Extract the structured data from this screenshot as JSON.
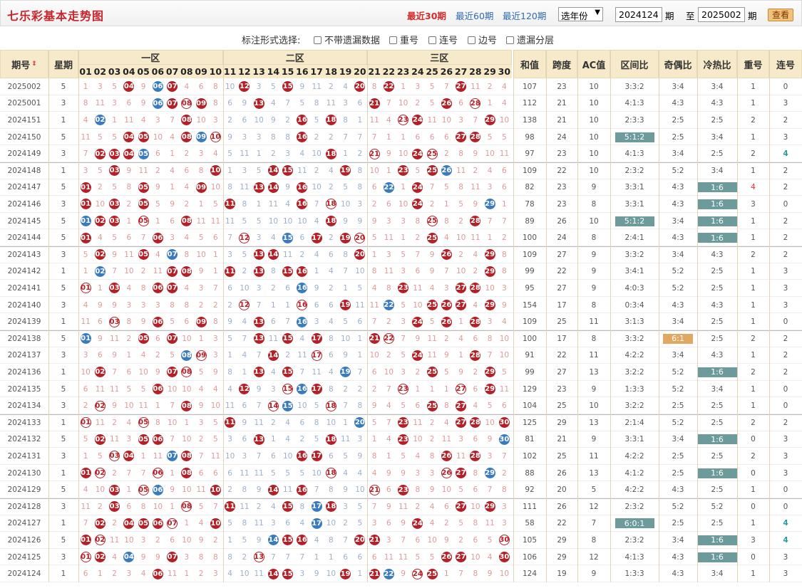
{
  "page": {
    "title": "七乐彩基本走势图",
    "range": [
      "最近30期",
      "最近60期",
      "最近120期"
    ],
    "year_select": "选年份",
    "from": "2024124",
    "to": "2025002",
    "qi": "期",
    "zhi": "至",
    "view": "查看"
  },
  "options": {
    "label": "标注形式选择:",
    "items": [
      "不带遗漏数据",
      "重号",
      "连号",
      "边号",
      "遗漏分层"
    ]
  },
  "headers": {
    "period": "期号",
    "week": "星期",
    "zones": [
      "一区",
      "二区",
      "三区"
    ],
    "numbers": [
      "01",
      "02",
      "03",
      "04",
      "05",
      "06",
      "07",
      "08",
      "09",
      "10",
      "11",
      "12",
      "13",
      "14",
      "15",
      "16",
      "17",
      "18",
      "19",
      "20",
      "21",
      "22",
      "23",
      "24",
      "25",
      "26",
      "27",
      "28",
      "29",
      "30"
    ],
    "stats": [
      "和值",
      "跨度",
      "AC值",
      "区间比",
      "奇偶比",
      "冷热比",
      "重号",
      "连号"
    ]
  },
  "rows": [
    {
      "p": "2025002",
      "w": "5",
      "hit": [
        "04",
        "06",
        "07",
        "12",
        "15",
        "20",
        "22",
        "27"
      ],
      "blue": [
        "06"
      ],
      "s": [
        "107",
        "23",
        "10",
        "3:3:2",
        "3:4",
        "3:4",
        "1",
        "0"
      ]
    },
    {
      "p": "2025001",
      "w": "3",
      "hit": [
        "06",
        "07",
        "08",
        "09",
        "13",
        "21",
        "26",
        "28"
      ],
      "blue": [
        "06"
      ],
      "s": [
        "112",
        "21",
        "10",
        "4:1:3",
        "4:3",
        "4:3",
        "1",
        "3"
      ]
    },
    {
      "p": "2024151",
      "w": "1",
      "hit": [
        "02",
        "08",
        "16",
        "18",
        "23",
        "24",
        "29"
      ],
      "blue": [
        "02"
      ],
      "s": [
        "138",
        "21",
        "10",
        "2:3:3",
        "2:5",
        "2:5",
        "2",
        "2"
      ]
    },
    {
      "p": "2024150",
      "w": "5",
      "hit": [
        "04",
        "05",
        "08",
        "09",
        "10",
        "16",
        "27",
        "28"
      ],
      "blue": [
        "09"
      ],
      "s": [
        "98",
        "24",
        "10",
        "5:1:2",
        "2:5",
        "3:4",
        "1",
        "3"
      ]
    },
    {
      "p": "2024149",
      "w": "3",
      "hit": [
        "02",
        "03",
        "04",
        "05",
        "18",
        "21",
        "24",
        "25"
      ],
      "blue": [
        "05"
      ],
      "s": [
        "97",
        "23",
        "10",
        "4:1:3",
        "3:4",
        "2:5",
        "2",
        "4"
      ]
    },
    {
      "p": "2024148",
      "w": "1",
      "hit": [
        "03",
        "10",
        "14",
        "15",
        "19",
        "23",
        "25",
        "26"
      ],
      "blue": [
        "26"
      ],
      "s": [
        "109",
        "22",
        "10",
        "2:3:2",
        "5:2",
        "3:4",
        "1",
        "2"
      ]
    },
    {
      "p": "2024147",
      "w": "5",
      "hit": [
        "01",
        "05",
        "09",
        "13",
        "14",
        "16",
        "22",
        "24"
      ],
      "blue": [
        "22"
      ],
      "s": [
        "82",
        "23",
        "9",
        "3:3:1",
        "4:3",
        "1:6",
        "4",
        "2"
      ]
    },
    {
      "p": "2024146",
      "w": "3",
      "hit": [
        "01",
        "03",
        "05",
        "11",
        "16",
        "18",
        "24",
        "29"
      ],
      "blue": [
        "29"
      ],
      "s": [
        "78",
        "23",
        "8",
        "3:3:1",
        "4:3",
        "1:6",
        "3",
        "0"
      ]
    },
    {
      "p": "2024145",
      "w": "5",
      "hit": [
        "01",
        "02",
        "03",
        "05",
        "08",
        "18",
        "25",
        "28"
      ],
      "blue": [
        "01"
      ],
      "s": [
        "89",
        "26",
        "10",
        "5:1:2",
        "3:4",
        "1:6",
        "1",
        "2"
      ]
    },
    {
      "p": "2024144",
      "w": "5",
      "hit": [
        "01",
        "06",
        "12",
        "15",
        "17",
        "19",
        "20",
        "25"
      ],
      "blue": [
        "15"
      ],
      "s": [
        "100",
        "24",
        "8",
        "2:4:1",
        "4:3",
        "1:6",
        "1",
        "2"
      ]
    },
    {
      "p": "2024143",
      "w": "3",
      "hit": [
        "02",
        "05",
        "07",
        "13",
        "14",
        "20",
        "26",
        "29"
      ],
      "blue": [
        "07"
      ],
      "s": [
        "109",
        "27",
        "9",
        "3:3:2",
        "3:4",
        "4:3",
        "2",
        "2"
      ]
    },
    {
      "p": "2024142",
      "w": "1",
      "hit": [
        "02",
        "07",
        "08",
        "11",
        "13",
        "15",
        "16",
        "29"
      ],
      "blue": [
        "02"
      ],
      "s": [
        "99",
        "22",
        "9",
        "3:4:1",
        "5:2",
        "2:5",
        "1",
        "3"
      ]
    },
    {
      "p": "2024141",
      "w": "5",
      "hit": [
        "01",
        "03",
        "06",
        "07",
        "16",
        "23",
        "27",
        "28"
      ],
      "blue": [
        "16"
      ],
      "s": [
        "95",
        "27",
        "9",
        "4:0:3",
        "5:2",
        "2:5",
        "1",
        "3"
      ]
    },
    {
      "p": "2024140",
      "w": "3",
      "hit": [
        "12",
        "16",
        "19",
        "22",
        "25",
        "26",
        "27",
        "29"
      ],
      "blue": [
        "22"
      ],
      "s": [
        "154",
        "17",
        "8",
        "0:3:4",
        "4:3",
        "4:3",
        "1",
        "3"
      ]
    },
    {
      "p": "2024139",
      "w": "1",
      "hit": [
        "03",
        "06",
        "09",
        "13",
        "16",
        "24",
        "26",
        "28"
      ],
      "blue": [
        "16"
      ],
      "s": [
        "109",
        "25",
        "11",
        "3:1:3",
        "3:4",
        "2:5",
        "1",
        "0"
      ]
    },
    {
      "p": "2024138",
      "w": "5",
      "hit": [
        "01",
        "05",
        "07",
        "13",
        "15",
        "17",
        "21",
        "22"
      ],
      "blue": [
        "01"
      ],
      "s": [
        "100",
        "17",
        "8",
        "3:3:2",
        "6:1",
        "2:5",
        "2",
        "2"
      ]
    },
    {
      "p": "2024137",
      "w": "3",
      "hit": [
        "08",
        "09",
        "14",
        "17",
        "24",
        "28"
      ],
      "blue": [
        "08"
      ],
      "s": [
        "91",
        "22",
        "11",
        "4:2:2",
        "3:4",
        "4:3",
        "1",
        "2"
      ]
    },
    {
      "p": "2024136",
      "w": "1",
      "hit": [
        "02",
        "07",
        "08",
        "13",
        "15",
        "19",
        "25",
        "29"
      ],
      "blue": [
        "19"
      ],
      "s": [
        "99",
        "27",
        "13",
        "3:2:2",
        "5:2",
        "1:6",
        "2",
        "2"
      ]
    },
    {
      "p": "2024135",
      "w": "5",
      "hit": [
        "06",
        "12",
        "15",
        "16",
        "17",
        "23",
        "27",
        "29"
      ],
      "blue": [
        "16"
      ],
      "s": [
        "129",
        "23",
        "9",
        "1:3:3",
        "5:2",
        "3:4",
        "1",
        "0"
      ]
    },
    {
      "p": "2024134",
      "w": "3",
      "hit": [
        "02",
        "08",
        "14",
        "15",
        "18",
        "25",
        "27"
      ],
      "blue": [
        "15"
      ],
      "s": [
        "104",
        "25",
        "10",
        "3:2:2",
        "2:5",
        "2:5",
        "1",
        "0"
      ]
    },
    {
      "p": "2024133",
      "w": "1",
      "hit": [
        "01",
        "05",
        "11",
        "20",
        "23",
        "27",
        "28",
        "30"
      ],
      "blue": [
        "20"
      ],
      "s": [
        "125",
        "29",
        "13",
        "2:1:4",
        "5:2",
        "2:5",
        "2",
        "2"
      ]
    },
    {
      "p": "2024132",
      "w": "5",
      "hit": [
        "02",
        "05",
        "06",
        "13",
        "18",
        "23",
        "30"
      ],
      "blue": [
        "30"
      ],
      "s": [
        "81",
        "21",
        "9",
        "3:3:1",
        "3:4",
        "1:6",
        "0",
        "3"
      ]
    },
    {
      "p": "2024131",
      "w": "3",
      "hit": [
        "03",
        "04",
        "07",
        "08",
        "16",
        "17",
        "26",
        "28"
      ],
      "blue": [
        "07"
      ],
      "s": [
        "102",
        "25",
        "11",
        "4:2:2",
        "2:5",
        "2:5",
        "2",
        "3"
      ]
    },
    {
      "p": "2024130",
      "w": "1",
      "hit": [
        "01",
        "02",
        "06",
        "08",
        "18",
        "26",
        "27",
        "29"
      ],
      "blue": [
        "29"
      ],
      "s": [
        "88",
        "26",
        "13",
        "4:1:2",
        "2:5",
        "1:6",
        "0",
        "3"
      ]
    },
    {
      "p": "2024129",
      "w": "5",
      "hit": [
        "03",
        "05",
        "06",
        "10",
        "14",
        "16",
        "21",
        "23"
      ],
      "blue": [
        "06"
      ],
      "s": [
        "92",
        "20",
        "5",
        "4:2:2",
        "4:3",
        "2:5",
        "1",
        "0"
      ]
    },
    {
      "p": "2024128",
      "w": "3",
      "hit": [
        "03",
        "08",
        "11",
        "15",
        "17",
        "18",
        "27",
        "29"
      ],
      "blue": [
        "17"
      ],
      "s": [
        "111",
        "26",
        "12",
        "2:3:2",
        "5:2",
        "5:2",
        "0",
        "0"
      ]
    },
    {
      "p": "2024127",
      "w": "1",
      "hit": [
        "02",
        "04",
        "05",
        "06",
        "07",
        "10",
        "17",
        "24"
      ],
      "blue": [
        "17"
      ],
      "s": [
        "58",
        "22",
        "7",
        "6:0:1",
        "2:5",
        "2:5",
        "1",
        "4"
      ]
    },
    {
      "p": "2024126",
      "w": "5",
      "hit": [
        "01",
        "02",
        "14",
        "15",
        "16",
        "20",
        "21",
        "30"
      ],
      "blue": [
        "14"
      ],
      "s": [
        "105",
        "29",
        "8",
        "2:3:2",
        "3:4",
        "1:6",
        "3",
        "4"
      ]
    },
    {
      "p": "2024125",
      "w": "3",
      "hit": [
        "01",
        "02",
        "04",
        "07",
        "13",
        "26",
        "27",
        "30"
      ],
      "blue": [
        "04"
      ],
      "s": [
        "106",
        "29",
        "12",
        "4:1:3",
        "4:3",
        "1:6",
        "0",
        "3"
      ]
    },
    {
      "p": "2024124",
      "w": "1",
      "hit": [
        "06",
        "14",
        "15",
        "19",
        "21",
        "22",
        "24",
        "25"
      ],
      "blue": [
        "22"
      ],
      "s": [
        "124",
        "19",
        "9",
        "1:3:3",
        "4:3",
        "3:4",
        "1",
        "3"
      ]
    }
  ]
}
